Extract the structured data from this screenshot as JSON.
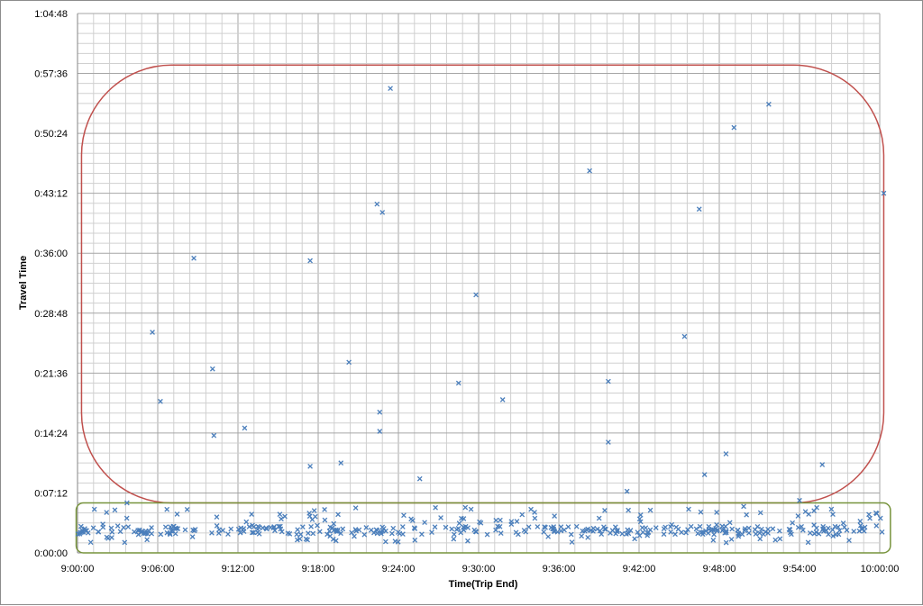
{
  "chart_data": {
    "type": "scatter",
    "xlabel": "Time(Trip End)",
    "ylabel": "Travel Time",
    "x_ticks": [
      "9:00:00",
      "9:06:00",
      "9:12:00",
      "9:18:00",
      "9:24:00",
      "9:30:00",
      "9:36:00",
      "9:42:00",
      "9:48:00",
      "9:54:00",
      "10:00:00"
    ],
    "y_ticks": [
      "0:00:00",
      "0:07:12",
      "0:14:24",
      "0:21:36",
      "0:28:48",
      "0:36:00",
      "0:43:12",
      "0:50:24",
      "0:57:36",
      "1:04:48"
    ],
    "xlim": [
      "9:00:00",
      "10:00:00"
    ],
    "ylim": [
      "0:00:00",
      "1:04:48"
    ],
    "grid": true,
    "marker": "x",
    "series_color": "#4a7ebb",
    "highlight_regions": [
      {
        "color": "#c0504d",
        "x_range": [
          "9:00:18",
          "10:00:18"
        ],
        "y_range": [
          "0:06:00",
          "0:58:36"
        ]
      },
      {
        "color": "#77933c",
        "x_range": [
          "8:59:54",
          "10:00:48"
        ],
        "y_range": [
          "0:00:00",
          "0:06:00"
        ]
      }
    ],
    "outliers": [
      [
        "9:05:36",
        "0:26:30"
      ],
      [
        "9:06:12",
        "0:18:12"
      ],
      [
        "9:08:42",
        "0:35:24"
      ],
      [
        "9:10:06",
        "0:22:06"
      ],
      [
        "9:10:12",
        "0:14:06"
      ],
      [
        "9:12:30",
        "0:15:00"
      ],
      [
        "9:17:24",
        "0:35:06"
      ],
      [
        "9:17:24",
        "0:10:24"
      ],
      [
        "9:19:42",
        "0:10:48"
      ],
      [
        "9:20:18",
        "0:22:54"
      ],
      [
        "9:22:24",
        "0:41:54"
      ],
      [
        "9:22:48",
        "0:40:54"
      ],
      [
        "9:23:24",
        "0:55:48"
      ],
      [
        "9:22:36",
        "0:16:54"
      ],
      [
        "9:22:36",
        "0:14:36"
      ],
      [
        "9:25:36",
        "0:08:54"
      ],
      [
        "9:28:30",
        "0:20:24"
      ],
      [
        "9:29:48",
        "0:31:00"
      ],
      [
        "9:31:48",
        "0:18:24"
      ],
      [
        "9:38:18",
        "0:45:54"
      ],
      [
        "9:39:42",
        "0:20:36"
      ],
      [
        "9:39:42",
        "0:13:18"
      ],
      [
        "9:41:06",
        "0:07:24"
      ],
      [
        "9:45:24",
        "0:26:00"
      ],
      [
        "9:46:30",
        "0:41:18"
      ],
      [
        "9:46:54",
        "0:09:24"
      ],
      [
        "9:48:30",
        "0:11:54"
      ],
      [
        "9:49:06",
        "0:51:06"
      ],
      [
        "9:51:42",
        "0:53:54"
      ],
      [
        "9:55:42",
        "0:10:36"
      ],
      [
        "9:54:00",
        "0:06:18"
      ],
      [
        "10:00:18",
        "0:43:12"
      ],
      [
        "9:03:42",
        "0:06:00"
      ]
    ],
    "cluster": {
      "count": 420,
      "y_range": [
        "0:01:12",
        "0:05:36"
      ],
      "typical": "0:02:42",
      "x_range": [
        "9:00:00",
        "10:00:18"
      ]
    }
  }
}
